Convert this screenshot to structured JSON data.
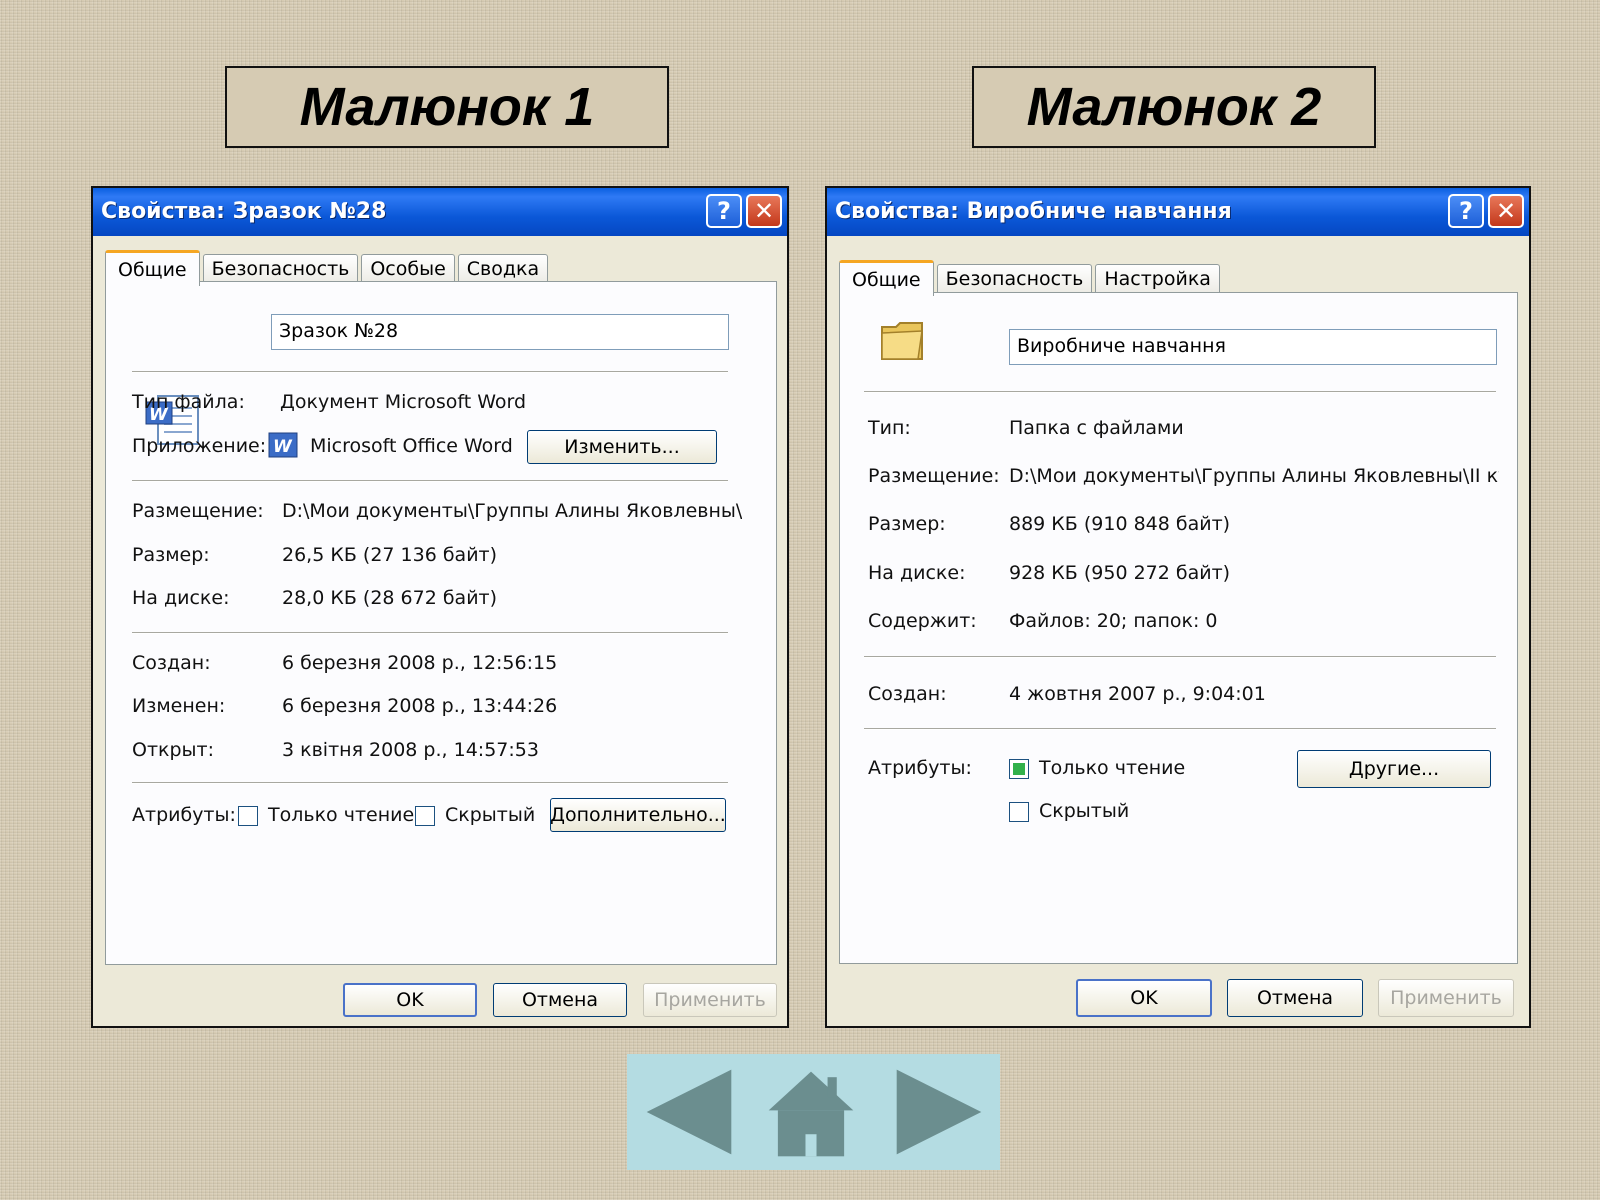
{
  "captions": {
    "left": "Малюнок 1",
    "right": "Малюнок 2"
  },
  "window1": {
    "title": "Свойства: Зразок №28",
    "help_glyph": "?",
    "close_glyph": "✕",
    "tabs": [
      "Общие",
      "Безопасность",
      "Особые",
      "Сводка"
    ],
    "name_value": "Зразок №28",
    "file_type_label": "Тип файла:",
    "file_type_value": "Документ Microsoft Word",
    "app_label": "Приложение:",
    "app_value": "Microsoft Office Word",
    "change_button": "Изменить...",
    "location_label": "Размещение:",
    "location_value": "D:\\Мои документы\\Группы Алины Яковлевны\\",
    "size_label": "Размер:",
    "size_value": "26,5 КБ (27 136 байт)",
    "disk_label": "На диске:",
    "disk_value": "28,0 КБ (28 672 байт)",
    "created_label": "Создан:",
    "created_value": "6 березня 2008 р., 12:56:15",
    "modified_label": "Изменен:",
    "modified_value": "6 березня 2008 р., 13:44:26",
    "opened_label": "Открыт:",
    "opened_value": "3 квітня 2008 р., 14:57:53",
    "attributes_label": "Атрибуты:",
    "readonly_label": "Только чтение",
    "hidden_label": "Скрытый",
    "advanced_button": "Дополнительно...",
    "ok_button": "OK",
    "cancel_button": "Отмена",
    "apply_button": "Применить"
  },
  "window2": {
    "title": "Свойства: Виробниче навчання",
    "help_glyph": "?",
    "close_glyph": "✕",
    "tabs": [
      "Общие",
      "Безопасность",
      "Настройка"
    ],
    "name_value": "Виробниче навчання",
    "type_label": "Тип:",
    "type_value": "Папка с файлами",
    "location_label": "Размещение:",
    "location_value": "D:\\Мои документы\\Группы Алины Яковлевны\\II ку",
    "size_label": "Размер:",
    "size_value": "889 КБ (910 848 байт)",
    "disk_label": "На диске:",
    "disk_value": "928 КБ (950 272 байт)",
    "contains_label": "Содержит:",
    "contains_value": "Файлов: 20; папок: 0",
    "created_label": "Создан:",
    "created_value": "4 жовтня 2007 р., 9:04:01",
    "attributes_label": "Атрибуты:",
    "readonly_label": "Только чтение",
    "readonly_checked": true,
    "hidden_label": "Скрытый",
    "other_button": "Другие...",
    "ok_button": "OK",
    "cancel_button": "Отмена",
    "apply_button": "Применить"
  },
  "navigation": {
    "icons": [
      "arrow-left-icon",
      "home-icon",
      "arrow-right-icon"
    ],
    "color": "#6b8e8f"
  }
}
